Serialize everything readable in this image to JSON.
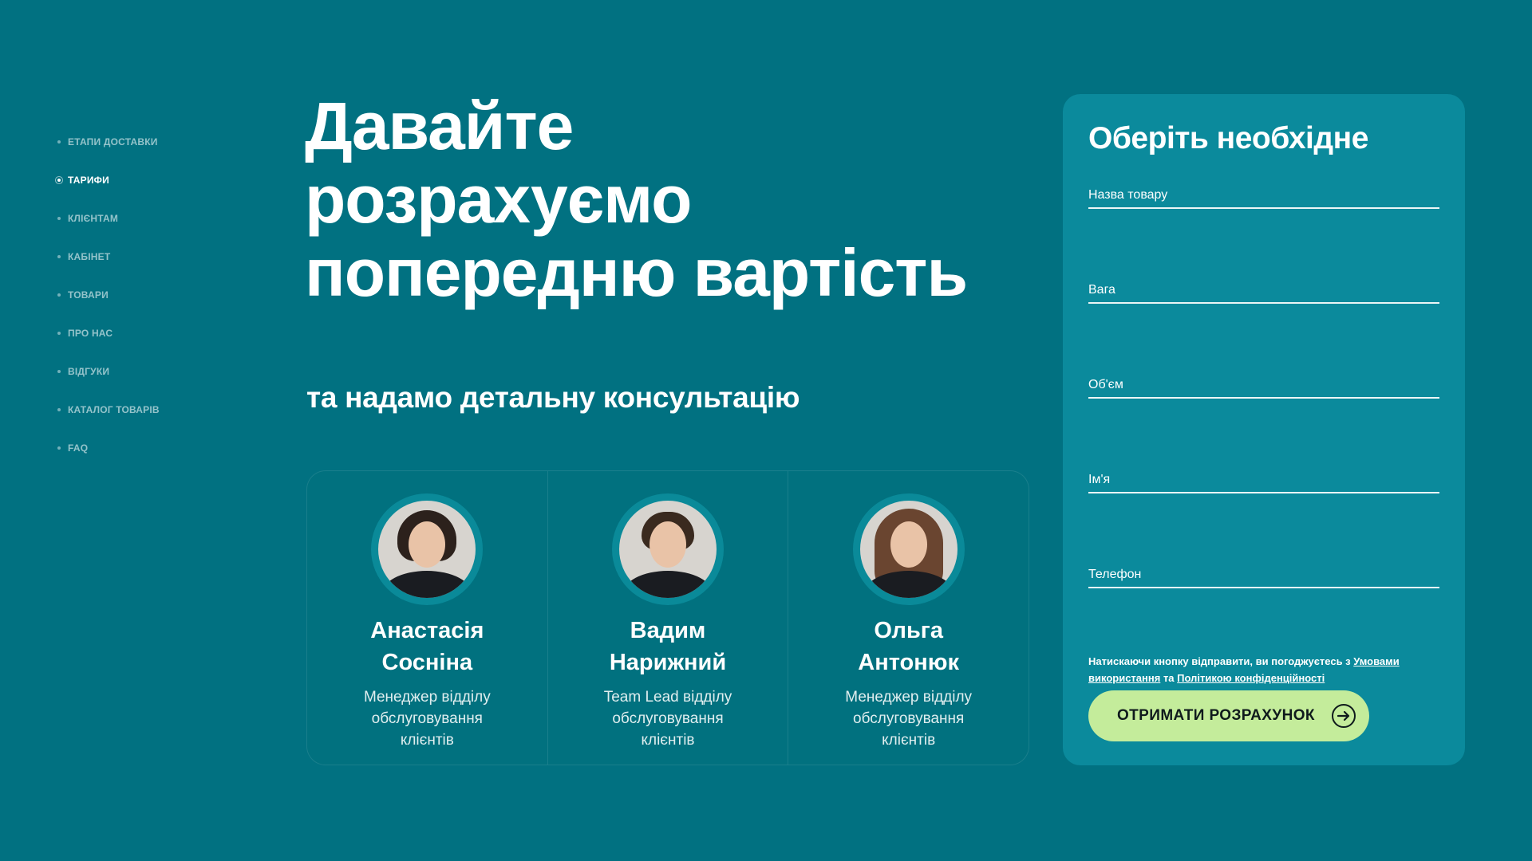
{
  "nav": {
    "items": [
      {
        "label": "ЕТАПИ ДОСТАВКИ",
        "active": false
      },
      {
        "label": "ТАРИФИ",
        "active": true
      },
      {
        "label": "КЛІЄНТАМ",
        "active": false
      },
      {
        "label": "КАБІНЕТ",
        "active": false
      },
      {
        "label": "ТОВАРИ",
        "active": false
      },
      {
        "label": "ПРО НАС",
        "active": false
      },
      {
        "label": "ВІДГУКИ",
        "active": false
      },
      {
        "label": "КАТАЛОГ ТОВАРІВ",
        "active": false
      },
      {
        "label": "FAQ",
        "active": false
      }
    ]
  },
  "hero": {
    "title_lines": [
      "Давайте",
      "розрахуємо",
      "попередню вартість"
    ],
    "subtitle": "та надамо детальну консультацію"
  },
  "managers": [
    {
      "name_lines": [
        "Анастасія",
        "Сосніна"
      ],
      "role_lines": [
        "Менеджер відділу",
        "обслуговування",
        "клієнтів"
      ]
    },
    {
      "name_lines": [
        "Вадим",
        "Нарижний"
      ],
      "role_lines": [
        "Team Lead відділу",
        "обслуговування",
        "клієнтів"
      ]
    },
    {
      "name_lines": [
        "Ольга",
        "Антонюк"
      ],
      "role_lines": [
        "Менеджер відділу",
        "обслуговування",
        "клієнтів"
      ]
    }
  ],
  "form": {
    "title": "Оберіть необхідне",
    "fields": [
      {
        "placeholder": "Назва товару",
        "value": ""
      },
      {
        "placeholder": "Вага",
        "value": ""
      },
      {
        "placeholder": "Об'єм",
        "value": ""
      },
      {
        "placeholder": "Ім'я",
        "value": ""
      },
      {
        "placeholder": "Телефон",
        "value": ""
      }
    ],
    "consent_prefix": "Натискаючи кнопку відправити, ви погоджуєтесь з",
    "terms_link": "Умовами використання",
    "consent_middle": "та",
    "privacy_link": "Політикою конфіденційності",
    "submit_label": "ОТРИМАТИ РОЗРАХУНОК",
    "submit_icon": "arrow-right-circle-icon"
  },
  "colors": {
    "background": "#017181",
    "panel": "#0b8a9c",
    "submit_button": "#c4ec9b",
    "text": "#ffffff"
  }
}
